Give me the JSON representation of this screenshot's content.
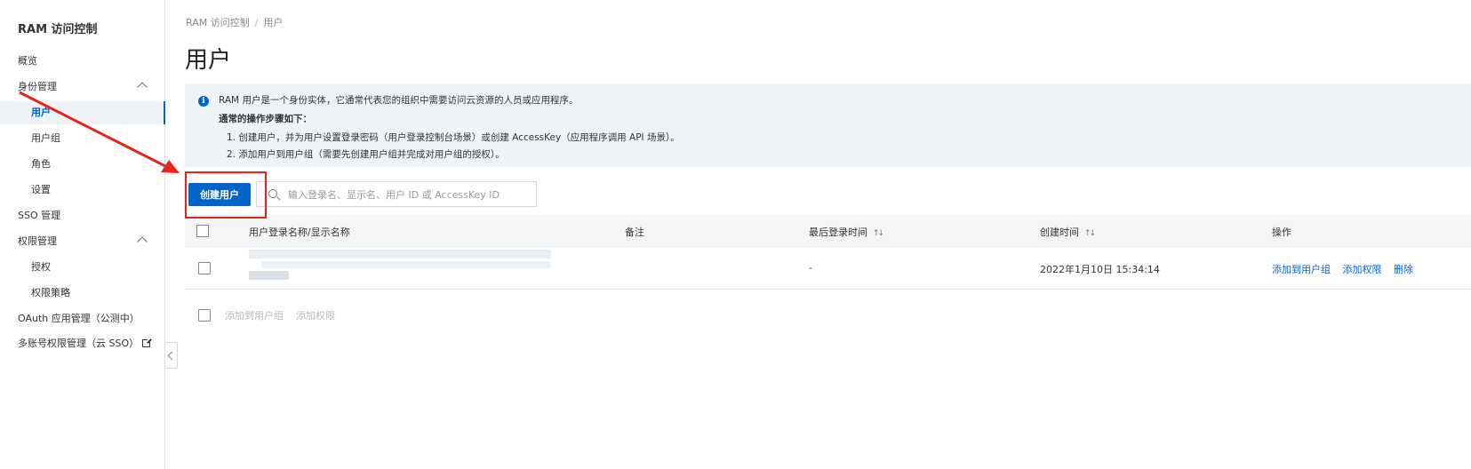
{
  "app": {
    "title": "RAM 访问控制"
  },
  "sidebar": {
    "items": [
      {
        "label": "概览"
      },
      {
        "label": "身份管理"
      },
      {
        "label": "用户"
      },
      {
        "label": "用户组"
      },
      {
        "label": "角色"
      },
      {
        "label": "设置"
      },
      {
        "label": "SSO 管理"
      },
      {
        "label": "权限管理"
      },
      {
        "label": "授权"
      },
      {
        "label": "权限策略"
      },
      {
        "label": "OAuth 应用管理（公测中）"
      },
      {
        "label": "多账号权限管理（云 SSO）"
      }
    ],
    "active": "用户"
  },
  "breadcrumb": {
    "root": "RAM 访问控制",
    "sep": "/",
    "current": "用户"
  },
  "page": {
    "title": "用户"
  },
  "info": {
    "line1": "RAM 用户是一个身份实体，它通常代表您的组织中需要访问云资源的人员或应用程序。",
    "heading": "通常的操作步骤如下：",
    "step1": "1. 创建用户，并为用户设置登录密码（用户登录控制台场景）或创建 AccessKey（应用程序调用 API 场景）。",
    "step2": "2. 添加用户到用户组（需要先创建用户组并完成对用户组的授权）。"
  },
  "toolbar": {
    "create_label": "创建用户",
    "search_placeholder": "输入登录名、显示名、用户 ID 或 AccessKey ID"
  },
  "table": {
    "columns": [
      "用户登录名称/显示名称",
      "备注",
      "最后登录时间",
      "创建时间",
      "操作"
    ],
    "rows": [
      {
        "name": "",
        "remark": "",
        "last_login": "-",
        "created": "2022年1月10日 15:34:14",
        "actions": [
          "添加到用户组",
          "添加权限",
          "删除"
        ]
      }
    ]
  },
  "batch_actions": [
    "添加到用户组",
    "添加权限"
  ],
  "colors": {
    "primary": "#0064c8",
    "annotation": "#e8231a",
    "accent": "#ff6a00"
  }
}
